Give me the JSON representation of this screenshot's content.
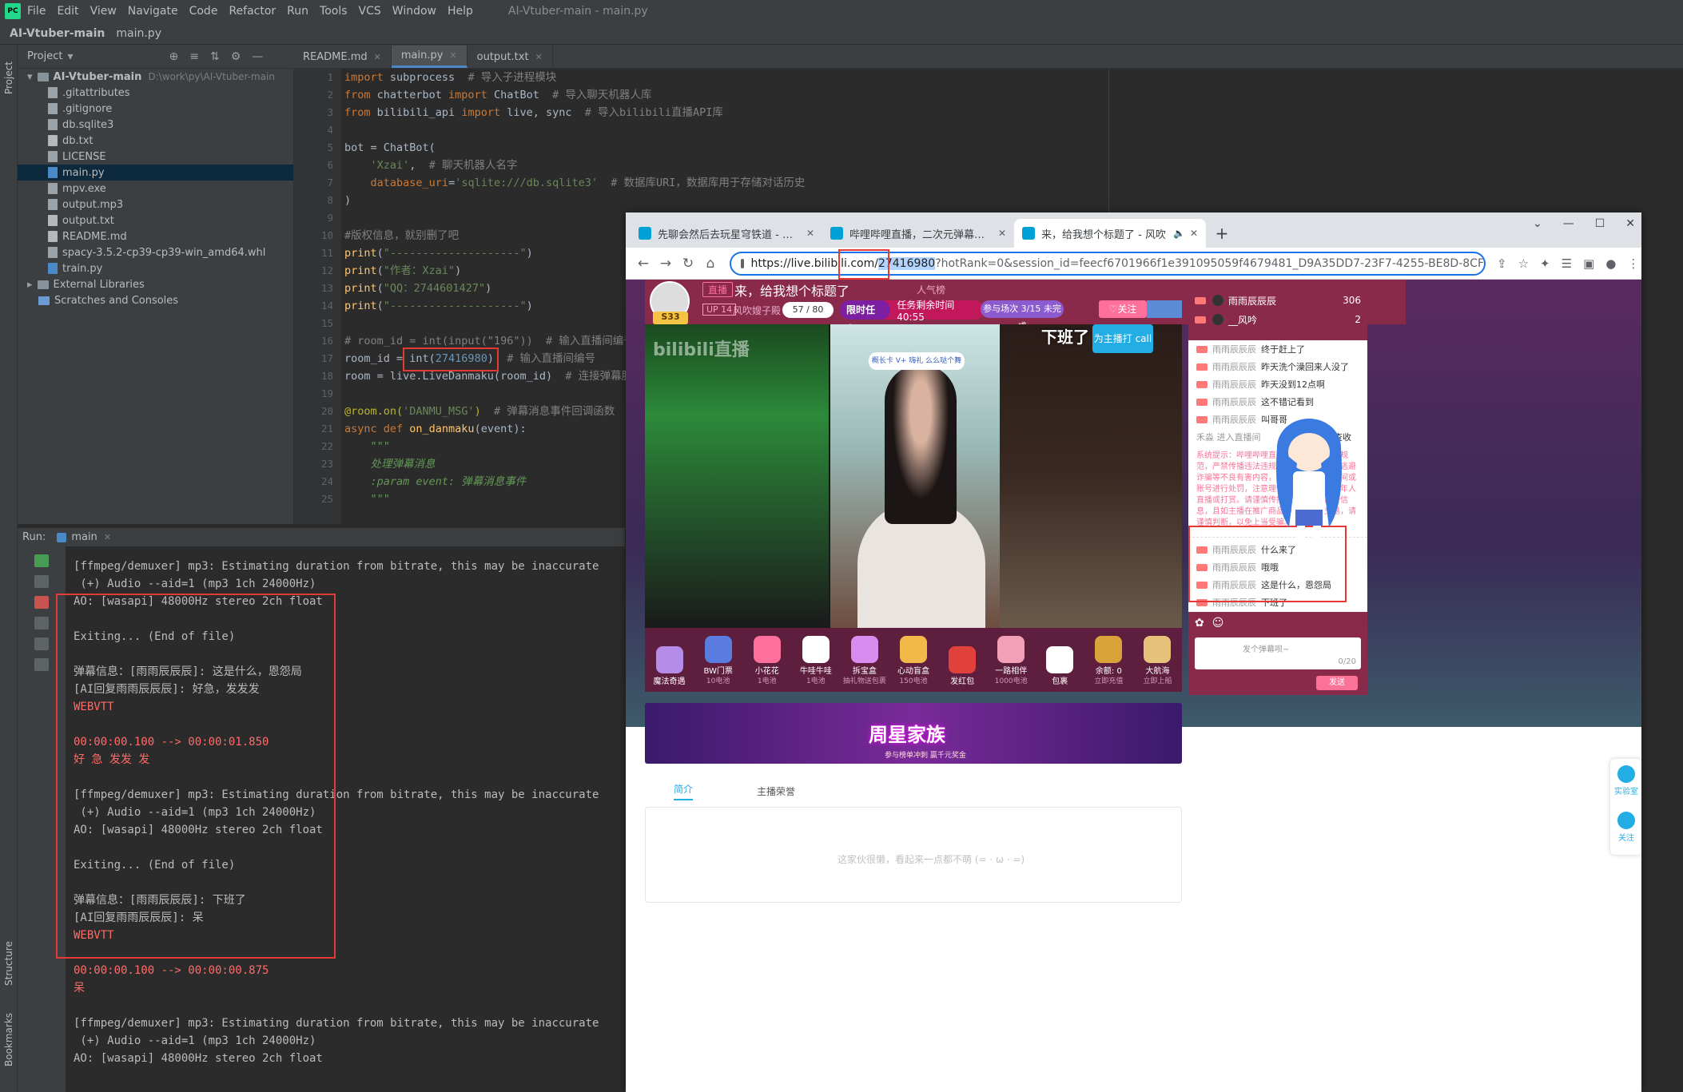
{
  "ide": {
    "menu": [
      "File",
      "Edit",
      "View",
      "Navigate",
      "Code",
      "Refactor",
      "Run",
      "Tools",
      "VCS",
      "Window",
      "Help"
    ],
    "window_title": "AI-Vtuber-main - main.py",
    "logo": "PC",
    "breadcrumb": [
      "AI-Vtuber-main",
      "main.py"
    ],
    "project_label": "Project",
    "structure_label": "Structure",
    "bookmarks_label": "Bookmarks",
    "tree": {
      "root": "AI-Vtuber-main",
      "root_path": "D:\\work\\py\\AI-Vtuber-main",
      "files": [
        ".gitattributes",
        ".gitignore",
        "db.sqlite3",
        "db.txt",
        "LICENSE",
        "main.py",
        "mpv.exe",
        "output.mp3",
        "output.txt",
        "README.md",
        "spacy-3.5.2-cp39-cp39-win_amd64.whl",
        "train.py"
      ],
      "selected": "main.py",
      "extra": [
        "External Libraries",
        "Scratches and Consoles"
      ]
    },
    "tabs": [
      "README.md",
      "main.py",
      "output.txt"
    ],
    "active_tab": "main.py",
    "line_numbers": [
      "1",
      "2",
      "3",
      "4",
      "5",
      "6",
      "7",
      "8",
      "9",
      "10",
      "11",
      "12",
      "13",
      "14",
      "15",
      "16",
      "17",
      "18",
      "19",
      "20",
      "21",
      "22",
      "23",
      "24",
      "25"
    ],
    "code": [
      {
        "parts": [
          [
            "kw",
            "import "
          ],
          [
            "",
            "subprocess  "
          ],
          [
            "cmt",
            "# 导入子进程模块"
          ]
        ]
      },
      {
        "parts": [
          [
            "kw",
            "from "
          ],
          [
            "",
            "chatterbot "
          ],
          [
            "kw",
            "import "
          ],
          [
            "",
            "ChatBot  "
          ],
          [
            "cmt",
            "# 导入聊天机器人库"
          ]
        ]
      },
      {
        "parts": [
          [
            "kw",
            "from "
          ],
          [
            "",
            "bilibili_api "
          ],
          [
            "kw",
            "import "
          ],
          [
            "",
            "live, sync  "
          ],
          [
            "cmt",
            "# 导入bilibili直播API库"
          ]
        ]
      },
      {
        "parts": [
          [
            "",
            ""
          ]
        ]
      },
      {
        "parts": [
          [
            "",
            "bot = ChatBot("
          ]
        ]
      },
      {
        "parts": [
          [
            "",
            "    "
          ],
          [
            "str",
            "'Xzai'"
          ],
          [
            "",
            ",  "
          ],
          [
            "cmt",
            "# 聊天机器人名字"
          ]
        ]
      },
      {
        "parts": [
          [
            "",
            "    "
          ],
          [
            "kw",
            "database_uri"
          ],
          [
            "",
            "="
          ],
          [
            "str",
            "'sqlite:///db.sqlite3'"
          ],
          [
            "",
            "  "
          ],
          [
            "cmt",
            "# 数据库URI，数据库用于存储对话历史"
          ]
        ]
      },
      {
        "parts": [
          [
            "",
            ")"
          ]
        ]
      },
      {
        "parts": [
          [
            "",
            ""
          ]
        ]
      },
      {
        "parts": [
          [
            "cmt",
            "#版权信息，就别删了吧"
          ]
        ]
      },
      {
        "parts": [
          [
            "fn",
            "print"
          ],
          [
            "",
            "("
          ],
          [
            "str",
            "\"--------------------\""
          ],
          [
            "",
            ")"
          ]
        ]
      },
      {
        "parts": [
          [
            "fn",
            "print"
          ],
          [
            "",
            "("
          ],
          [
            "str",
            "\"作者：Xzai\""
          ],
          [
            "",
            ")"
          ]
        ]
      },
      {
        "parts": [
          [
            "fn",
            "print"
          ],
          [
            "",
            "("
          ],
          [
            "str",
            "\"QQ：2744601427\""
          ],
          [
            "",
            ")"
          ]
        ]
      },
      {
        "parts": [
          [
            "fn",
            "print"
          ],
          [
            "",
            "("
          ],
          [
            "str",
            "\"--------------------\""
          ],
          [
            "",
            ")"
          ]
        ]
      },
      {
        "parts": [
          [
            "",
            ""
          ]
        ]
      },
      {
        "parts": [
          [
            "cmt",
            "# room_id = int(input(\"196\"))  # 输入直播间编号"
          ]
        ]
      },
      {
        "parts": [
          [
            "",
            "room_id = "
          ],
          [
            "",
            "int("
          ],
          [
            "num",
            "27416980"
          ],
          [
            "",
            ")  "
          ],
          [
            "cmt",
            "# 输入直播间编号"
          ]
        ]
      },
      {
        "parts": [
          [
            "",
            "room = live.LiveDanmaku(room_id)  "
          ],
          [
            "cmt",
            "# 连接弹幕服务器"
          ]
        ]
      },
      {
        "parts": [
          [
            "",
            ""
          ]
        ]
      },
      {
        "parts": [
          [
            "dec",
            "@room.on("
          ],
          [
            "str",
            "'DANMU_MSG'"
          ],
          [
            "dec",
            ")"
          ],
          [
            "",
            "  "
          ],
          [
            "cmt",
            "# 弹幕消息事件回调函数"
          ]
        ]
      },
      {
        "parts": [
          [
            "kw",
            "async def "
          ],
          [
            "fn",
            "on_danmaku"
          ],
          [
            "",
            "(event):"
          ]
        ]
      },
      {
        "parts": [
          [
            "",
            "    "
          ],
          [
            "doc",
            "\"\"\""
          ]
        ]
      },
      {
        "parts": [
          [
            "",
            "    "
          ],
          [
            "doc",
            "处理弹幕消息"
          ]
        ]
      },
      {
        "parts": [
          [
            "",
            "    "
          ],
          [
            "doc",
            ":param event: 弹幕消息事件"
          ]
        ]
      },
      {
        "parts": [
          [
            "",
            "    "
          ],
          [
            "doc",
            "\"\"\""
          ]
        ]
      }
    ],
    "run_label": "Run:",
    "run_config": "main",
    "console": [
      {
        "t": "[ffmpeg/demuxer] mp3: Estimating duration from bitrate, this may be inaccurate",
        "c": ""
      },
      {
        "t": " (+) Audio --aid=1 (mp3 1ch 24000Hz)",
        "c": ""
      },
      {
        "t": "AO: [wasapi] 48000Hz stereo 2ch float",
        "c": ""
      },
      {
        "t": "",
        "c": "gap"
      },
      {
        "t": "Exiting... (End of file)",
        "c": ""
      },
      {
        "t": "",
        "c": "gap"
      },
      {
        "t": "弹幕信息：[雨雨辰辰辰]: 这是什么，恩怨局",
        "c": ""
      },
      {
        "t": "[AI回复雨雨辰辰辰]: 好急，发发发",
        "c": ""
      },
      {
        "t": "WEBVTT",
        "c": "red"
      },
      {
        "t": "",
        "c": "gap"
      },
      {
        "t": "00:00:00.100 --> 00:00:01.850",
        "c": "red"
      },
      {
        "t": "好 急 发发 发",
        "c": "red"
      },
      {
        "t": "",
        "c": "gap"
      },
      {
        "t": "[ffmpeg/demuxer] mp3: Estimating duration from bitrate, this may be inaccurate",
        "c": ""
      },
      {
        "t": " (+) Audio --aid=1 (mp3 1ch 24000Hz)",
        "c": ""
      },
      {
        "t": "AO: [wasapi] 48000Hz stereo 2ch float",
        "c": ""
      },
      {
        "t": "",
        "c": "gap"
      },
      {
        "t": "Exiting... (End of file)",
        "c": ""
      },
      {
        "t": "",
        "c": "gap"
      },
      {
        "t": "弹幕信息：[雨雨辰辰辰]: 下班了",
        "c": ""
      },
      {
        "t": "[AI回复雨雨辰辰辰]: 呆",
        "c": ""
      },
      {
        "t": "WEBVTT",
        "c": "red"
      },
      {
        "t": "",
        "c": "gap"
      },
      {
        "t": "00:00:00.100 --> 00:00:00.875",
        "c": "red"
      },
      {
        "t": "呆",
        "c": "red"
      },
      {
        "t": "",
        "c": "gap"
      },
      {
        "t": "[ffmpeg/demuxer] mp3: Estimating duration from bitrate, this may be inaccurate",
        "c": ""
      },
      {
        "t": " (+) Audio --aid=1 (mp3 1ch 24000Hz)",
        "c": ""
      },
      {
        "t": "AO: [wasapi] 48000Hz stereo 2ch float",
        "c": ""
      }
    ]
  },
  "browser": {
    "tabs": [
      "先聊会然后去玩星穹铁道 - 小绿",
      "哔哩哔哩直播，二次元弹幕直播",
      "来，给我想个标题了 - 风吹"
    ],
    "active_tab": 2,
    "url_prefix": "https://live.bilibili.com/",
    "url_room": "27416980",
    "url_rest": "?hotRank=0&session_id=feecf6701966f1e391095059f4679481_D9A35DD7-23F7-4255-BE8D-8CF",
    "win_controls": [
      "⌄",
      "—",
      "☐",
      "✕"
    ]
  },
  "live": {
    "live_tag": "直播",
    "title": "来，给我想个标题了",
    "level": "S33",
    "up_tag": "UP 14",
    "up_name": "风吹嫂子殿",
    "fans": "57 / 80",
    "task_label": "限时任务",
    "task_text": "任务剩余时间 40:55",
    "participation": "参与场次 3/15  未完成",
    "follow": "关注",
    "hot_label": "人气榜",
    "watermark": "bilibili直播",
    "video_sticker": "概长卡 V+ 嗨礼 么么哒个舞",
    "overlay_text": "下班了",
    "call_button": "为主播打 call",
    "gifts": [
      {
        "name": "魔法奇遇",
        "sub": "",
        "badge": "NEW"
      },
      {
        "name": "BW门票",
        "sub": "10电池",
        "badge": "预测"
      },
      {
        "name": "小花花",
        "sub": "1电池",
        "badge": ""
      },
      {
        "name": "牛哇牛哇",
        "sub": "1电池",
        "badge": ""
      },
      {
        "name": "拆宝盒",
        "sub": "抽礼物送包裹",
        "badge": "爆奖"
      },
      {
        "name": "心动盲盒",
        "sub": "150电池",
        "badge": "必得"
      },
      {
        "name": "发红包",
        "sub": "",
        "badge": ""
      },
      {
        "name": "一路相伴",
        "sub": "1000电池",
        "badge": "周星"
      },
      {
        "name": "包裹",
        "sub": "",
        "badge": ""
      },
      {
        "name": "余额: 0",
        "sub": "立即充值",
        "badge": ""
      },
      {
        "name": "大航海",
        "sub": "立即上船",
        "badge": ""
      }
    ],
    "rank": [
      {
        "name": "雨雨辰辰辰",
        "score": "306"
      },
      {
        "name": "__风吟",
        "score": "2"
      }
    ],
    "chat_top": [
      {
        "user": "雨雨辰辰辰",
        "msg": "终于赶上了"
      },
      {
        "user": "雨雨辰辰辰",
        "msg": "昨天洗个澡回来人没了"
      },
      {
        "user": "雨雨辰辰辰",
        "msg": "昨天没到12点啊"
      },
      {
        "user": "雨雨辰辰辰",
        "msg": "这不错记看到"
      },
      {
        "user": "雨雨辰辰辰",
        "msg": "叫哥哥"
      }
    ],
    "chat_enter": "禾淼 进入直播间",
    "chat_enter_extra": "查收",
    "sys_note": "系统提示：哔哩哔哩直播间依法遵守直播规范，严禁传播违法违规、低俗暴力信息，逃避诈骗等不良有害内容，平台将对违规直播间或账号进行处罚，注意理性打赏，严禁未成年人直播或打赏。请谨慎传播，游戏诈骗广告信息，且如主播在推广商品中诱导私下交易，请谨慎判断，以免上当受骗。",
    "chat_bottom": [
      {
        "user": "雨雨辰辰辰",
        "msg": "什么来了"
      },
      {
        "user": "雨雨辰辰辰",
        "msg": "哦哦"
      },
      {
        "user": "雨雨辰辰辰",
        "msg": "这是什么，恩怨局"
      },
      {
        "user": "雨雨辰辰辰",
        "msg": "下班了"
      }
    ],
    "input_placeholder": "发个弹幕呗~",
    "input_count": "0/20",
    "send": "发送",
    "banner_title": "周星家族",
    "banner_sub": "参与榜单冲刺 赢千元奖金",
    "tab_intro": "简介",
    "tab_honor": "主播荣誉",
    "empty_text": "这家伙很懒，看起来一点都不萌 (= · ω · =)",
    "side_lab": "实验室",
    "side_follow": "关注"
  }
}
